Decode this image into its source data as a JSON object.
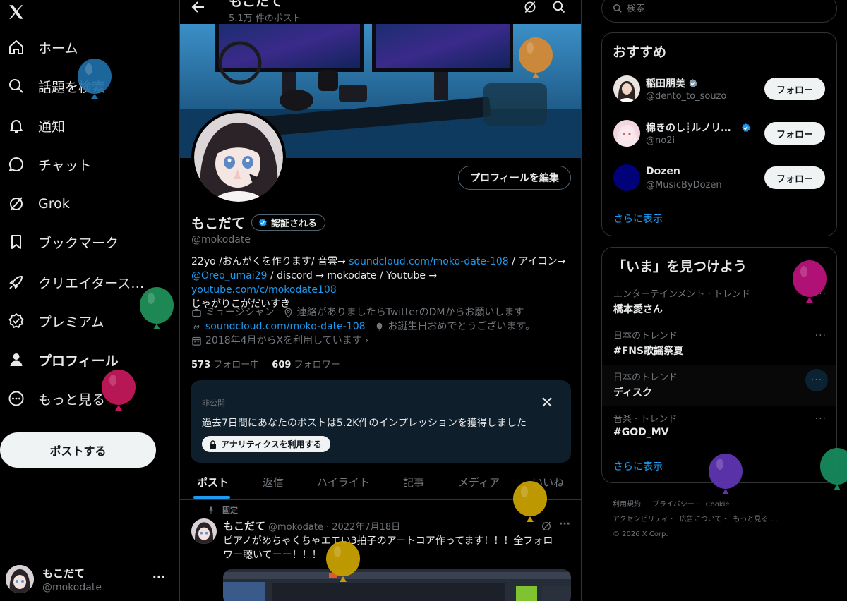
{
  "nav": {
    "logo": "x-logo-icon",
    "items": [
      {
        "label": "ホーム",
        "icon": "home-icon"
      },
      {
        "label": "話題を検索",
        "icon": "search-icon"
      },
      {
        "label": "通知",
        "icon": "bell-icon"
      },
      {
        "label": "チャット",
        "icon": "chat-icon"
      },
      {
        "label": "Grok",
        "icon": "grok-icon"
      },
      {
        "label": "ブックマーク",
        "icon": "bookmark-icon"
      },
      {
        "label": "クリエイタース…",
        "icon": "rocket-icon"
      },
      {
        "label": "プレミアム",
        "icon": "premium-icon"
      },
      {
        "label": "プロフィール",
        "icon": "person-icon"
      },
      {
        "label": "もっと見る",
        "icon": "more-circle-icon"
      }
    ],
    "post_button": "ポストする",
    "account": {
      "name": "もこだて",
      "handle": "@mokodate",
      "menu": "···"
    }
  },
  "header": {
    "title": "もこだて",
    "post_count": "5.1万 件のポスト"
  },
  "profile": {
    "name": "もこだて",
    "verified_label": "認証される",
    "handle": "@mokodate",
    "edit_button": "プロフィールを編集",
    "bio": {
      "t1": "22yo /おんがくを作ります/ 音雲→ ",
      "l1": "soundcloud.com/moko-date-108",
      "t2": " / アイコン→",
      "l2": "@Oreo_umai29",
      "t3": " / discord → mokodate / Youtube → ",
      "l3": "youtube.com/c/mokodate108",
      "line2": "じゃがりこがだいすき"
    },
    "meta": {
      "category": "ミュージシャン",
      "location": "連絡がありましたらTwitterのDMからお願いします",
      "url": "soundcloud.com/moko-date-108",
      "birthday": "お誕生日おめでとうございます。",
      "joined": "2018年4月からXを利用しています"
    },
    "following_count": "573",
    "following_label": "フォロー中",
    "followers_count": "609",
    "followers_label": "フォロワー"
  },
  "analytics": {
    "private_label": "非公開",
    "text": "過去7日間にあなたのポストは5.2K件のインプレッションを獲得しました",
    "button": "アナリティクスを利用する"
  },
  "tabs": [
    "ポスト",
    "返信",
    "ハイライト",
    "記事",
    "メディア",
    "いいね"
  ],
  "pinned_post": {
    "pinned_label": "固定",
    "name": "もこだて",
    "handle": "@mokodate",
    "date": "· 2022年7月18日",
    "text1": "ピアノがめちゃくちゃエモい3拍子のアートコア作ってます！！！全フォロ",
    "text2": "ワー聴いてーー！！！"
  },
  "search": {
    "placeholder": "検索"
  },
  "recommend": {
    "title": "おすすめ",
    "users": [
      {
        "name": "稲田朋美",
        "handle": "@dento_to_souzo",
        "button": "フォロー"
      },
      {
        "name": "棉きのし┊ルノリ…",
        "handle": "@no2i",
        "button": "フォロー"
      },
      {
        "name": "Dozen",
        "handle": "@MusicByDozen",
        "button": "フォロー"
      }
    ],
    "show_more": "さらに表示"
  },
  "trends": {
    "title": "「いま」を見つけよう",
    "items": [
      {
        "category": "エンターテインメント · トレンド",
        "title": "橋本愛さん"
      },
      {
        "category": "日本のトレンド",
        "title": "#FNS歌謡祭夏"
      },
      {
        "category": "日本のトレンド",
        "title": "ディスク"
      },
      {
        "category": "音楽 · トレンド",
        "title": "#GOD_MV"
      }
    ],
    "more": "···",
    "show_more": "さらに表示"
  },
  "footer": {
    "row1": [
      "利用規約",
      "プライバシー",
      "Cookie"
    ],
    "row2": [
      "アクセシビリティ",
      "広告について",
      "もっと見る …"
    ],
    "copyright": "© 2026 X Corp."
  },
  "colors": {
    "background": "#000000",
    "text": "#e7e9ea",
    "muted": "#71767b",
    "accent": "#1d9bf0",
    "border": "#2f3336",
    "balloons": [
      "#1f6fa8",
      "#d98a32",
      "#1f8f58",
      "#c2185b",
      "#b8127a",
      "#5e35b1",
      "#c8a000",
      "#168a5c"
    ]
  }
}
